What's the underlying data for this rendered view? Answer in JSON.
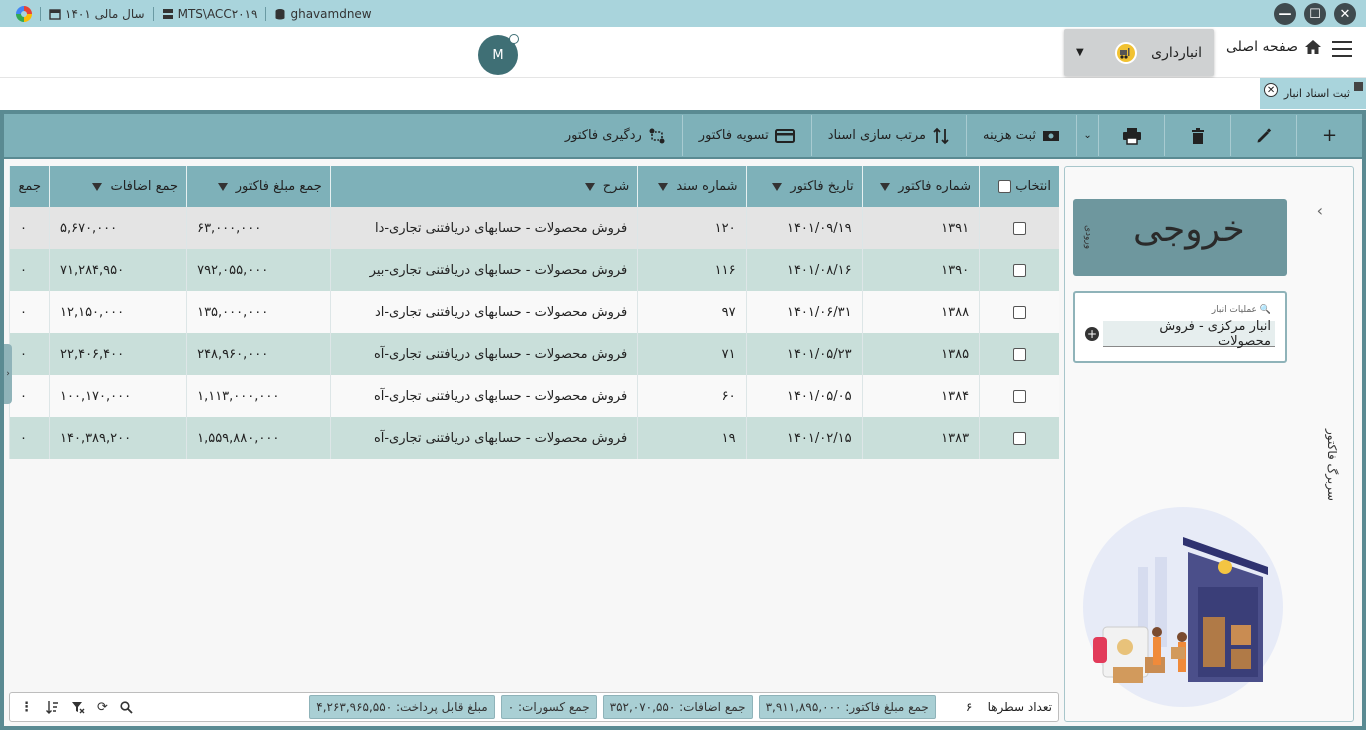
{
  "titlebar": {
    "db": "ghavamdnew",
    "server": "MTS\\ACC۲۰۱۹",
    "fiscal_year": "سال مالی ۱۴۰۱",
    "btn_minimize": "—",
    "btn_maximize": "☐",
    "btn_close": "✕"
  },
  "header": {
    "home_label": "صفحه اصلی",
    "module_label": "انبارداری",
    "avatar_initial": "M"
  },
  "tab": {
    "label": "ثبت اسناد انبار",
    "close": "✕"
  },
  "toolbar": {
    "expense_label": "ثبت هزینه",
    "sort_docs_label": "مرتب سازی اسناد",
    "settle_label": "تسویه فاکتور",
    "track_label": "ردگیری فاکتور"
  },
  "side": {
    "out_label": "خروجی",
    "in_label": "ورودی",
    "op_label": "عملیات انبار",
    "op_value": "انبار مرکزی - فروش محصولات",
    "vertical_label": "سربرگ فاکتور"
  },
  "table": {
    "headers": {
      "select": "انتخاب",
      "invoice_no": "شماره فاکتور",
      "invoice_date": "تاریخ فاکتور",
      "doc_no": "شماره سند",
      "description": "شرح",
      "invoice_total": "جمع مبلغ فاکتور",
      "additions_total": "جمع اضافات",
      "cut_col": "جمع"
    },
    "rows": [
      {
        "invoice_no": "۱۳۹۱",
        "date": "۱۴۰۱/۰۹/۱۹",
        "doc_no": "۱۲۰",
        "desc": "فروش محصولات - حسابهای دریافتنی تجاری-دا",
        "total": "۶۳,۰۰۰,۰۰۰",
        "additions": "۵,۶۷۰,۰۰۰",
        "cut": "۰"
      },
      {
        "invoice_no": "۱۳۹۰",
        "date": "۱۴۰۱/۰۸/۱۶",
        "doc_no": "۱۱۶",
        "desc": "فروش محصولات - حسابهای دریافتنی تجاری-بیر",
        "total": "۷۹۲,۰۵۵,۰۰۰",
        "additions": "۷۱,۲۸۴,۹۵۰",
        "cut": "۰"
      },
      {
        "invoice_no": "۱۳۸۸",
        "date": "۱۴۰۱/۰۶/۳۱",
        "doc_no": "۹۷",
        "desc": "فروش محصولات - حسابهای دریافتنی تجاری-اد",
        "total": "۱۳۵,۰۰۰,۰۰۰",
        "additions": "۱۲,۱۵۰,۰۰۰",
        "cut": "۰"
      },
      {
        "invoice_no": "۱۳۸۵",
        "date": "۱۴۰۱/۰۵/۲۳",
        "doc_no": "۷۱",
        "desc": "فروش محصولات - حسابهای دریافتنی تجاری-آه",
        "total": "۲۴۸,۹۶۰,۰۰۰",
        "additions": "۲۲,۴۰۶,۴۰۰",
        "cut": "۰"
      },
      {
        "invoice_no": "۱۳۸۴",
        "date": "۱۴۰۱/۰۵/۰۵",
        "doc_no": "۶۰",
        "desc": "فروش محصولات - حسابهای دریافتنی تجاری-آه",
        "total": "۱,۱۱۳,۰۰۰,۰۰۰",
        "additions": "۱۰۰,۱۷۰,۰۰۰",
        "cut": "۰"
      },
      {
        "invoice_no": "۱۳۸۳",
        "date": "۱۴۰۱/۰۲/۱۵",
        "doc_no": "۱۹",
        "desc": "فروش محصولات - حسابهای دریافتنی تجاری-آه",
        "total": "۱,۵۵۹,۸۸۰,۰۰۰",
        "additions": "۱۴۰,۳۸۹,۲۰۰",
        "cut": "۰"
      }
    ]
  },
  "footer": {
    "row_count_label": "تعداد سطرها",
    "row_count": "۶",
    "sum_invoice": "جمع مبلغ فاکتور: ۳,۹۱۱,۸۹۵,۰۰۰",
    "sum_additions": "جمع اضافات: ۳۵۲,۰۷۰,۵۵۰",
    "sum_deductions": "جمع کسورات: ۰",
    "payable": "مبلغ قابل پرداخت: ۴,۲۶۳,۹۶۵,۵۵۰"
  },
  "colors": {
    "accent": "#7eb1b9",
    "frame": "#5a8a92",
    "titlebar": "#a9d4dc",
    "row_alt": "#c9dfda"
  }
}
